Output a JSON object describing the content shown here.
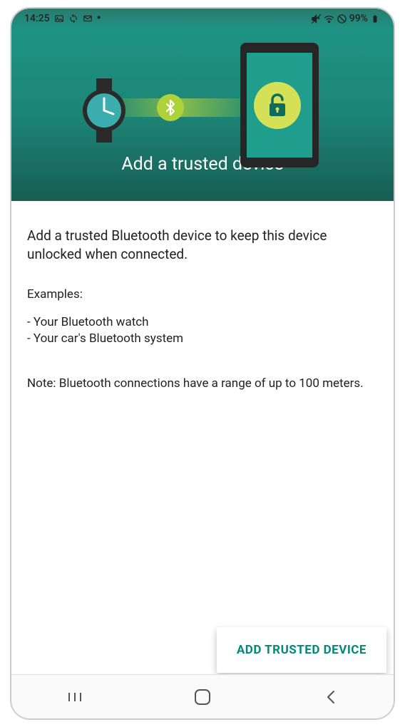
{
  "status_bar": {
    "time": "14:25",
    "battery_text": "99%"
  },
  "hero": {
    "title": "Add a trusted device"
  },
  "content": {
    "lead": "Add a trusted Bluetooth device to keep this device unlocked when connected.",
    "examples_label": "Examples:",
    "example1": "- Your Bluetooth watch",
    "example2": "- Your car's Bluetooth system",
    "note": "Note: Bluetooth connections have a range of up to 100 meters."
  },
  "fab": {
    "label": "ADD TRUSTED DEVICE"
  }
}
